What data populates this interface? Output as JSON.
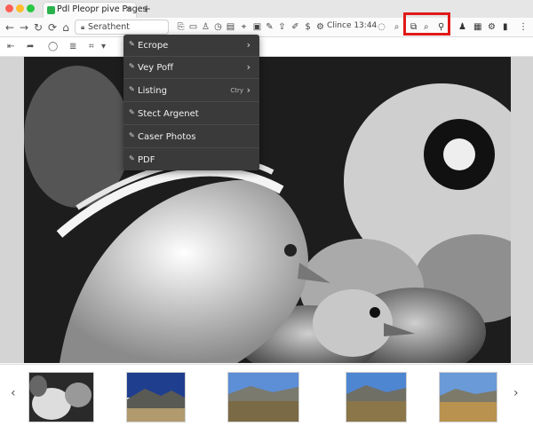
{
  "window": {
    "tab_title": "Pdl Pleopr pive Pages",
    "tab_close": "×",
    "new_tab": "+"
  },
  "toolbar": {
    "url": "Serathent",
    "clock": "Clince 13:44"
  },
  "menu": {
    "items": [
      {
        "label": "Ecrope",
        "hint": "",
        "arrow": "›"
      },
      {
        "label": "Vey Poff",
        "hint": "",
        "arrow": "›"
      },
      {
        "label": "Listing",
        "hint": "Ctry",
        "arrow": "›"
      },
      {
        "label": "Stect Argenet",
        "hint": "",
        "arrow": ""
      },
      {
        "label": "Caser Photos",
        "hint": "",
        "arrow": ""
      },
      {
        "label": "PDF",
        "hint": "",
        "arrow": ""
      }
    ]
  },
  "thumbnails": {
    "prev": "‹",
    "next": "›"
  },
  "colors": {
    "highlight": "#e11919",
    "menu_bg": "#3a3a3a"
  }
}
